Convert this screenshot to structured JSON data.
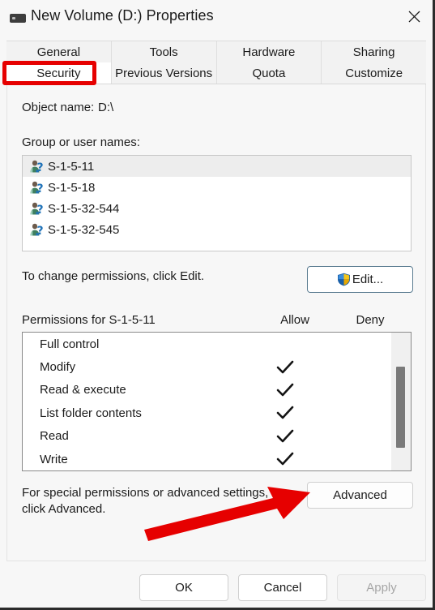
{
  "window": {
    "title": "New Volume (D:) Properties",
    "icon": "hard-drive-icon",
    "close_label": "✕"
  },
  "tabs": {
    "row1": [
      {
        "label": "General",
        "selected": false
      },
      {
        "label": "Tools",
        "selected": false
      },
      {
        "label": "Hardware",
        "selected": false
      },
      {
        "label": "Sharing",
        "selected": false
      }
    ],
    "row2": [
      {
        "label": "Security",
        "selected": true
      },
      {
        "label": "Previous Versions",
        "selected": false
      },
      {
        "label": "Quota",
        "selected": false
      },
      {
        "label": "Customize",
        "selected": false
      }
    ]
  },
  "security": {
    "object_name_label": "Object name:",
    "object_name_value": "D:\\",
    "groups_label": "Group or user names:",
    "users": [
      {
        "name": "S-1-5-11",
        "selected": true,
        "icon": "unknown-user-icon"
      },
      {
        "name": "S-1-5-18",
        "selected": false,
        "icon": "unknown-user-icon"
      },
      {
        "name": "S-1-5-32-544",
        "selected": false,
        "icon": "unknown-user-icon"
      },
      {
        "name": "S-1-5-32-545",
        "selected": false,
        "icon": "unknown-user-icon"
      }
    ],
    "edit_hint": "To change permissions, click Edit.",
    "edit_button": "Edit...",
    "permissions_header": "Permissions for S-1-5-11",
    "allow_column": "Allow",
    "deny_column": "Deny",
    "permissions": [
      {
        "name": "Full control",
        "allow": false,
        "deny": false
      },
      {
        "name": "Modify",
        "allow": true,
        "deny": false
      },
      {
        "name": "Read & execute",
        "allow": true,
        "deny": false
      },
      {
        "name": "List folder contents",
        "allow": true,
        "deny": false
      },
      {
        "name": "Read",
        "allow": true,
        "deny": false
      },
      {
        "name": "Write",
        "allow": true,
        "deny": false
      }
    ],
    "advanced_hint": "For special permissions or advanced settings, click Advanced.",
    "advanced_button": "Advanced"
  },
  "footer": {
    "ok": "OK",
    "cancel": "Cancel",
    "apply": "Apply",
    "apply_enabled": false
  },
  "annotations": {
    "color": "#e60000",
    "highlight_target": "Security",
    "arrow_target": "Advanced"
  },
  "colors": {
    "dialog_bg": "#f7f7f7",
    "field_bg": "#ffffff",
    "selection": "#ededed",
    "annotation_red": "#e60000",
    "shield_blue": "#3a8ddc",
    "shield_yellow": "#f5c518",
    "disabled_text": "#a6a6a6"
  }
}
